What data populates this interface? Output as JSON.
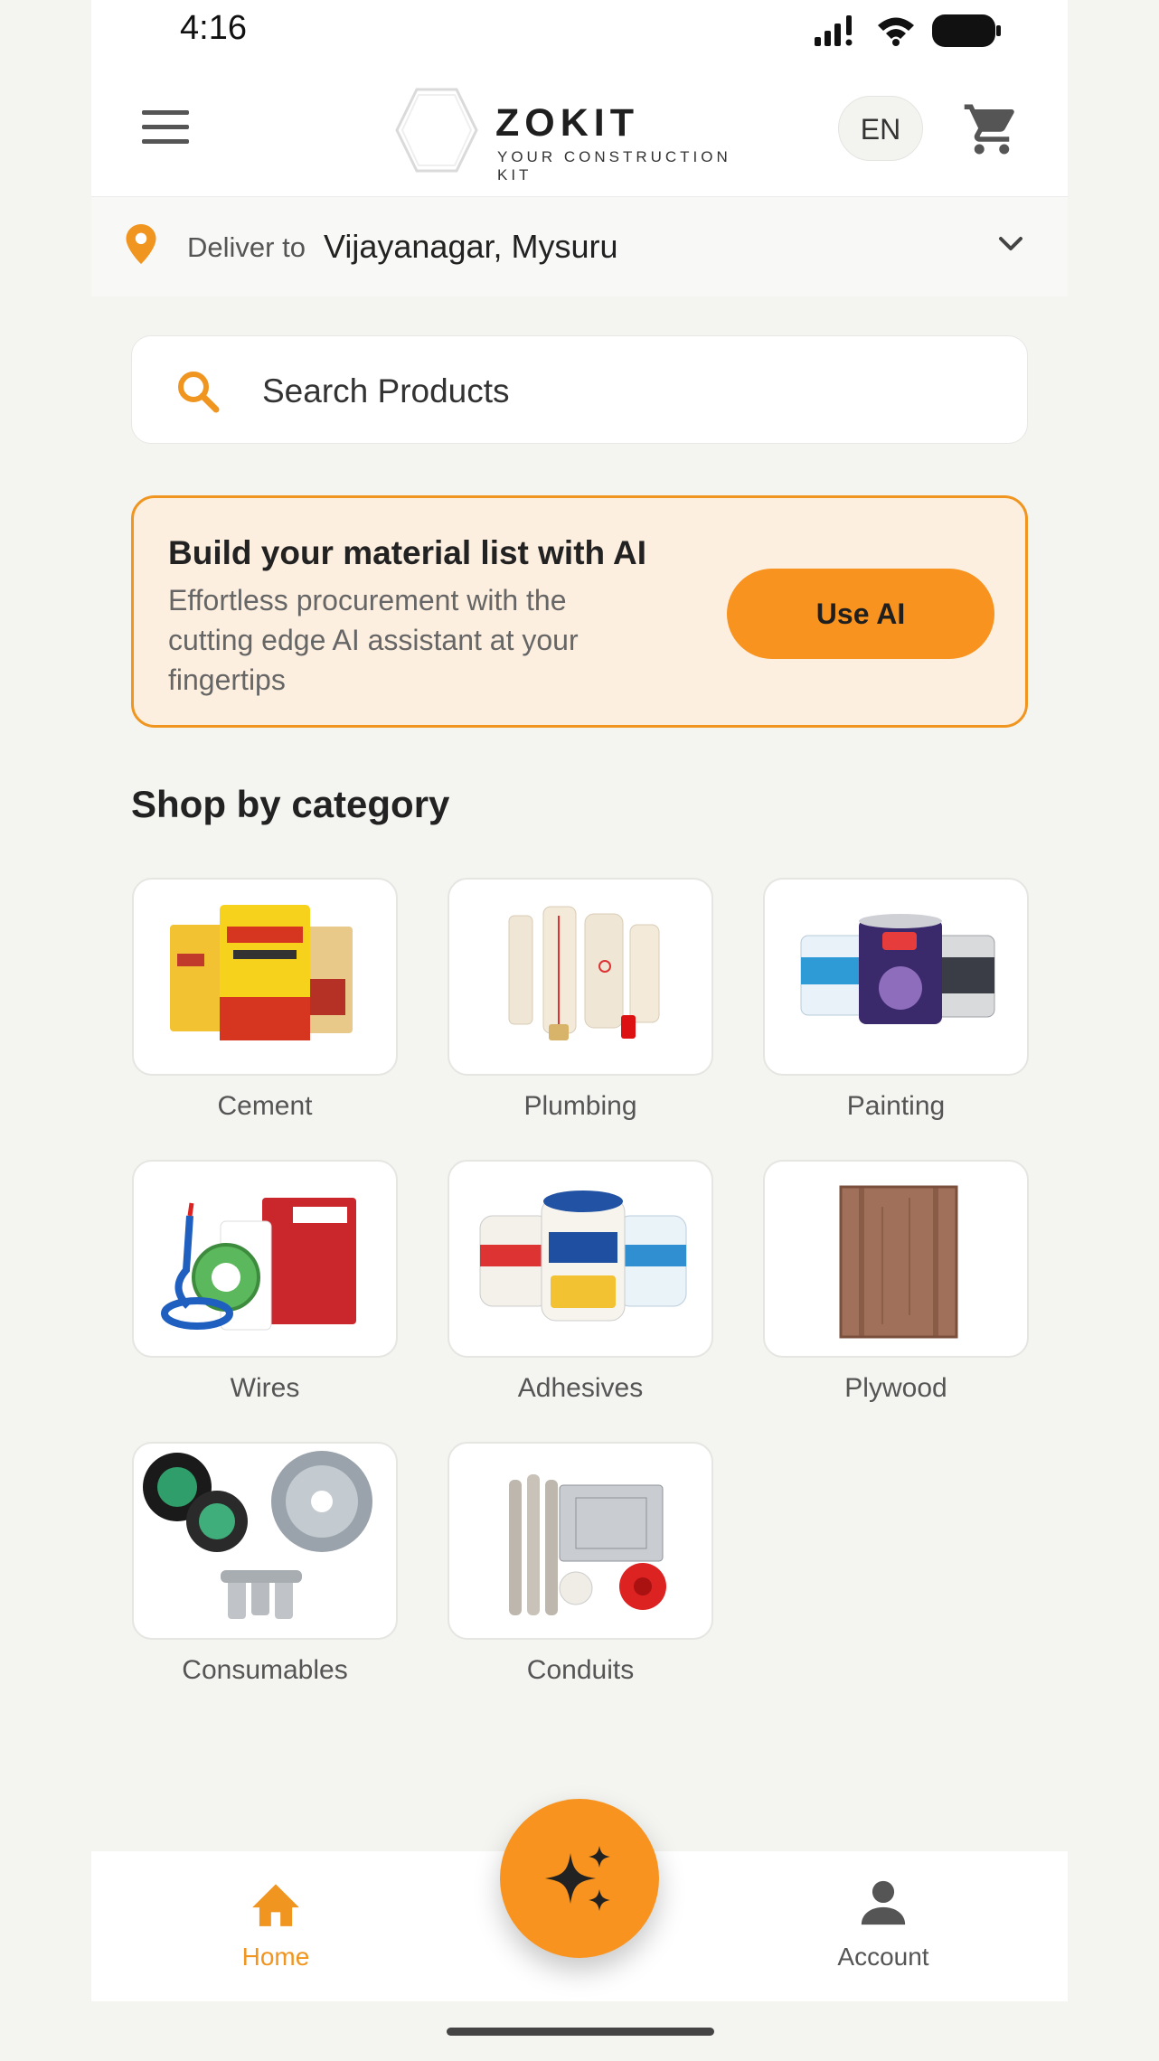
{
  "status_bar": {
    "time": "4:16"
  },
  "header": {
    "brand_name": "ZOKIT",
    "brand_tagline": "YOUR CONSTRUCTION KIT",
    "language": "EN"
  },
  "delivery": {
    "label": "Deliver to",
    "location": "Vijayanagar, Mysuru"
  },
  "search": {
    "placeholder": "Search Products"
  },
  "ai_banner": {
    "title": "Build your material list with AI",
    "description": "Effortless procurement with the cutting edge AI assistant at your fingertips",
    "button_label": "Use AI"
  },
  "categories_section": {
    "title": "Shop by category",
    "items": [
      {
        "label": "Cement"
      },
      {
        "label": "Plumbing"
      },
      {
        "label": "Painting"
      },
      {
        "label": "Wires"
      },
      {
        "label": "Adhesives"
      },
      {
        "label": "Plywood"
      },
      {
        "label": "Consumables"
      },
      {
        "label": "Conduits"
      }
    ]
  },
  "bottom_nav": {
    "home_label": "Home",
    "account_label": "Account"
  },
  "colors": {
    "accent": "#f7931e",
    "banner_bg": "#fdefdf",
    "background": "#f4f4f1"
  }
}
